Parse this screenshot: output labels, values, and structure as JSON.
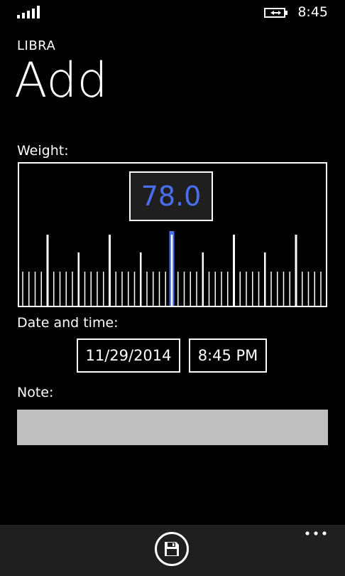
{
  "status": {
    "time": "8:45",
    "signal_icon": "signal-bars-icon",
    "battery_icon": "battery-charging-icon"
  },
  "header": {
    "app_title": "LIBRA",
    "page_title": "Add"
  },
  "weight": {
    "label": "Weight:",
    "value": "78.0",
    "accent_color": "#4a6ef0"
  },
  "datetime": {
    "label": "Date and time:",
    "date": "11/29/2014",
    "time": "8:45 PM"
  },
  "note": {
    "label": "Note:",
    "value": ""
  },
  "appbar": {
    "save_icon": "save-icon",
    "more_icon": "more-options-icon"
  }
}
